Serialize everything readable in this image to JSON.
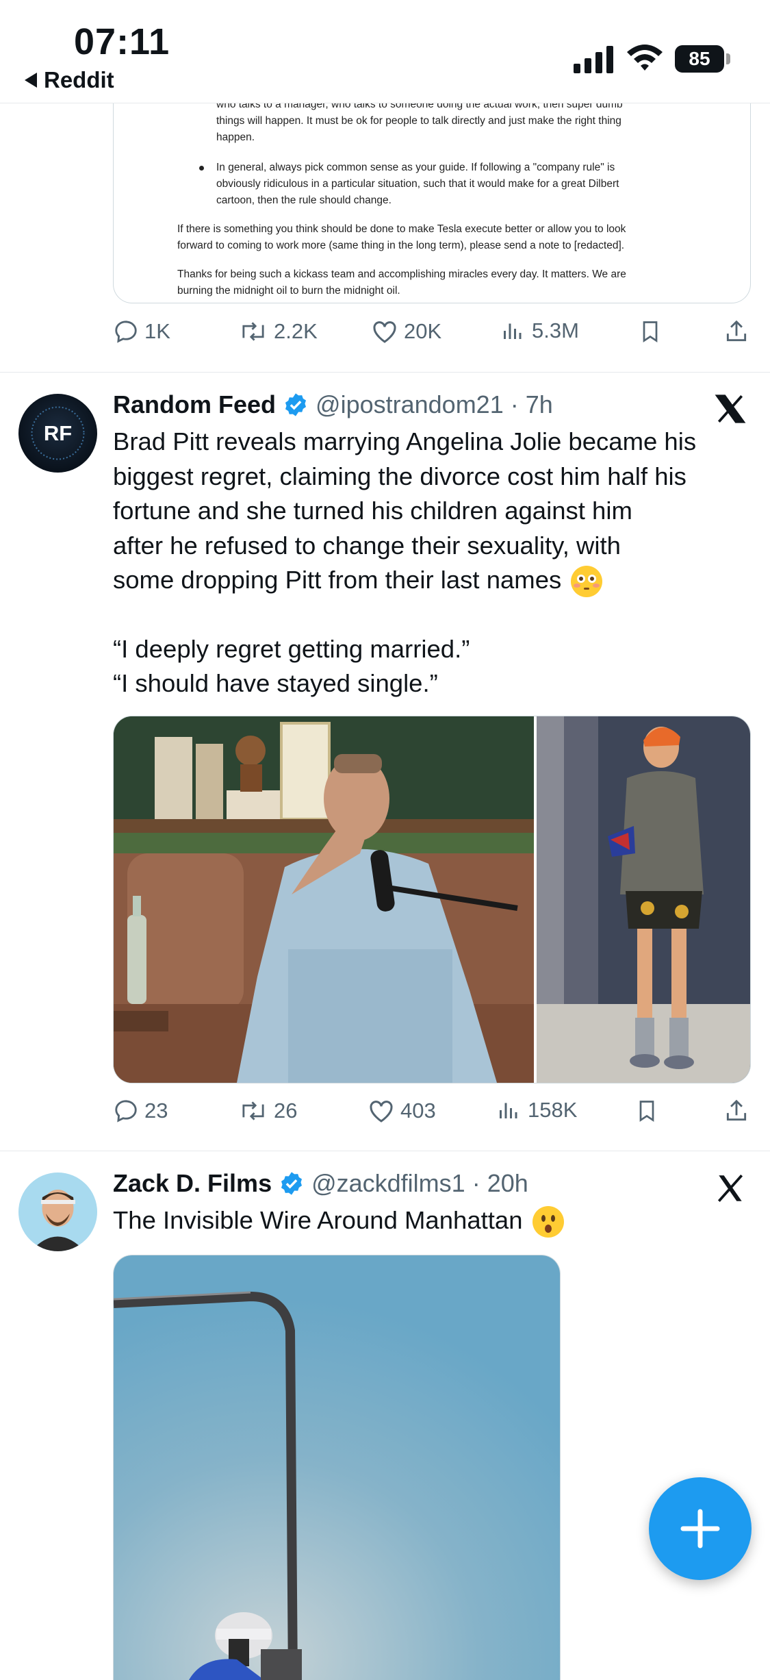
{
  "status_bar": {
    "time": "07:11",
    "back_app": "Reddit",
    "battery": "85"
  },
  "doc_excerpt": {
    "lines": [
      "who talks to a manager, who talks to someone doing the actual work, then super dumb",
      "things will happen. It must be ok for people to talk directly and just make the right thing",
      "happen.",
      "In general, always pick common sense as your guide. If following a \"company rule\" is",
      "obviously ridiculous in a particular situation, such that it would make for a great Dilbert",
      "cartoon, then the rule should change.",
      "If there is something you think should be done to make Tesla execute better or allow you to look",
      "forward to coming to work more (same thing in the long term), please send a note to [redacted].",
      "Thanks for being such a kickass team and accomplishing miracles every day. It matters. We are",
      "burning the midnight oil to burn the midnight oil."
    ]
  },
  "tweets": [
    {
      "actions": {
        "replies": "1K",
        "reposts": "2.2K",
        "likes": "20K",
        "views": "5.3M"
      }
    },
    {
      "avatar_text": "RF",
      "name": "Random Feed",
      "handle": "@ipostrandom21",
      "time": "· 7h",
      "text_lines": [
        "Brad Pitt reveals marrying Angelina Jolie became his",
        "biggest regret, claiming the divorce cost him half his",
        "fortune and she turned his children against him",
        "after he refused to change their sexuality, with",
        "some dropping Pitt from their last names"
      ],
      "quote_lines": [
        "“I deeply regret getting married.”",
        "“I should have stayed single.”"
      ],
      "actions": {
        "replies": "23",
        "reposts": "26",
        "likes": "403",
        "views": "158K"
      }
    },
    {
      "name": "Zack D. Films",
      "handle": "@zackdfilms1",
      "time": "· 20h",
      "text": "The Invisible Wire Around Manhattan"
    }
  ],
  "icons": {
    "reply": "reply-icon",
    "repost": "repost-icon",
    "like": "like-icon",
    "views": "views-icon",
    "bookmark": "bookmark-icon",
    "share": "share-icon",
    "verified": "verified-badge-icon",
    "x_logo": "x-logo-icon",
    "compose": "compose-plus-icon"
  },
  "colors": {
    "accent": "#1d9bf0",
    "secondary_text": "#536471",
    "divider": "#e6e9ec"
  }
}
